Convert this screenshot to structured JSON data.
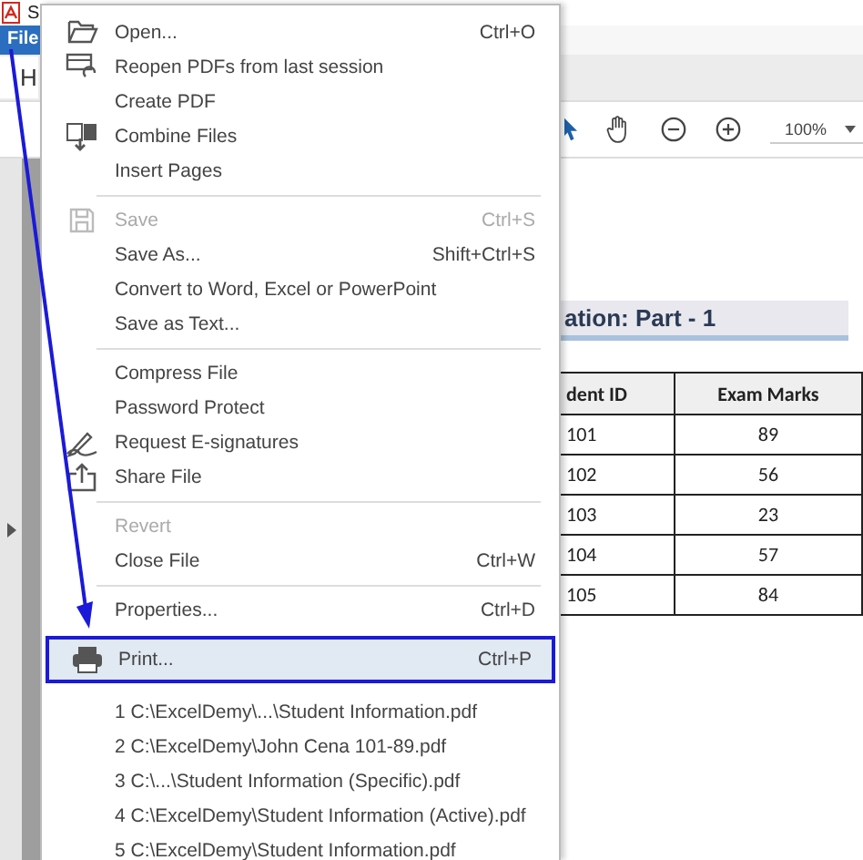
{
  "window": {
    "title": "S"
  },
  "menubar": [
    {
      "label": "File",
      "selected": true
    }
  ],
  "tabs": [
    {
      "label": "H",
      "selected": true
    }
  ],
  "toolbar": {
    "zoom": "100%"
  },
  "file_menu": {
    "groups": [
      {
        "items": [
          {
            "label": "Open...",
            "shortcut": "Ctrl+O",
            "disabled": false,
            "selected": false
          },
          {
            "label": "Reopen PDFs from last session",
            "disabled": false,
            "selected": false
          },
          {
            "label": "Create PDF",
            "disabled": false,
            "selected": false
          },
          {
            "label": "Combine Files",
            "disabled": false,
            "selected": false
          },
          {
            "label": "Insert Pages",
            "disabled": false,
            "selected": false
          }
        ]
      },
      {
        "items": [
          {
            "label": "Save",
            "shortcut": "Ctrl+S",
            "disabled": true,
            "selected": false
          },
          {
            "label": "Save As...",
            "shortcut": "Shift+Ctrl+S",
            "disabled": false,
            "selected": false
          },
          {
            "label": "Convert to Word, Excel or PowerPoint",
            "disabled": false,
            "selected": false
          },
          {
            "label": "Save as Text...",
            "disabled": false,
            "selected": false
          }
        ]
      },
      {
        "items": [
          {
            "label": "Compress File",
            "disabled": false,
            "selected": false
          },
          {
            "label": "Password Protect",
            "disabled": false,
            "selected": false
          },
          {
            "label": "Request E-signatures",
            "disabled": false,
            "selected": false
          },
          {
            "label": "Share File",
            "disabled": false,
            "selected": false
          }
        ]
      },
      {
        "items": [
          {
            "label": "Revert",
            "disabled": true,
            "selected": false
          },
          {
            "label": "Close File",
            "shortcut": "Ctrl+W",
            "disabled": false,
            "selected": false
          }
        ]
      },
      {
        "items": [
          {
            "label": "Properties...",
            "shortcut": "Ctrl+D",
            "disabled": false,
            "selected": false
          },
          {
            "label": "Print...",
            "shortcut": "Ctrl+P",
            "disabled": false,
            "selected": true
          },
          {
            "label": "1 C:\\ExcelDemy\\...\\Student Information.pdf",
            "disabled": false,
            "selected": false
          },
          {
            "label": "2 C:\\ExcelDemy\\John Cena 101-89.pdf",
            "disabled": false,
            "selected": false
          },
          {
            "label": "3 C:\\...\\Student Information (Specific).pdf",
            "disabled": false,
            "selected": false
          },
          {
            "label": "4 C:\\ExcelDemy\\Student Information (Active).pdf",
            "disabled": false,
            "selected": false
          },
          {
            "label": "5 C:\\ExcelDemy\\Student Information.pdf",
            "disabled": false,
            "selected": false
          }
        ]
      }
    ]
  },
  "document": {
    "heading": "ation: Part - 1",
    "table": {
      "columns": [
        "dent ID",
        "Exam Marks"
      ],
      "rows": [
        [
          "101",
          "89"
        ],
        [
          "102",
          "56"
        ],
        [
          "103",
          "23"
        ],
        [
          "104",
          "57"
        ],
        [
          "105",
          "84"
        ]
      ]
    }
  }
}
